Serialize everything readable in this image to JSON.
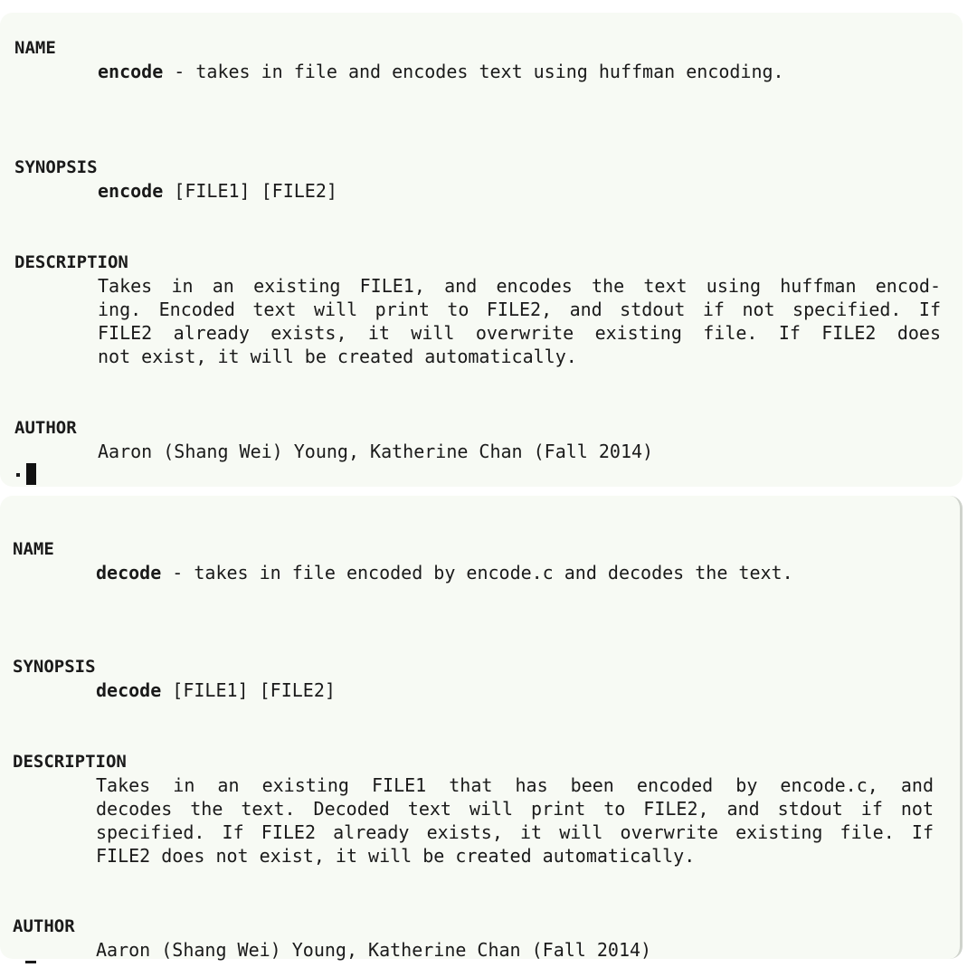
{
  "pages": [
    {
      "name": {
        "heading": "NAME",
        "command": "encode",
        "summary": " - takes in file and encodes text using huffman encoding."
      },
      "synopsis": {
        "heading": "SYNOPSIS",
        "command": "encode",
        "args": " [FILE1] [FILE2]"
      },
      "description": {
        "heading": "DESCRIPTION",
        "lines": [
          "Takes in an existing FILE1, and encodes the text using huffman encod-",
          "ing. Encoded text will print to FILE2, and stdout if not specified. If",
          "FILE2 already exists, it will overwrite existing file. If FILE2 does",
          "not exist, it will be created automatically."
        ]
      },
      "author": {
        "heading": "AUTHOR",
        "text": "Aaron (Shang Wei) Young, Katherine Chan (Fall 2014)"
      }
    },
    {
      "name": {
        "heading": "NAME",
        "command": "decode",
        "summary": " - takes in file encoded by encode.c and decodes the text."
      },
      "synopsis": {
        "heading": "SYNOPSIS",
        "command": "decode",
        "args": " [FILE1] [FILE2]"
      },
      "description": {
        "heading": "DESCRIPTION",
        "lines": [
          "Takes in an existing FILE1 that has been encoded by encode.c, and",
          "decodes the text. Decoded text will print to FILE2, and stdout if not",
          "specified. If FILE2 already exists, it will overwrite existing file. If",
          "FILE2 does not exist, it will be created automatically."
        ]
      },
      "author": {
        "heading": "AUTHOR",
        "text": "Aaron (Shang Wei) Young, Katherine Chan (Fall 2014)"
      }
    }
  ],
  "colors": {
    "panel_background": "#f7faf4",
    "text": "#1a1a1a"
  }
}
